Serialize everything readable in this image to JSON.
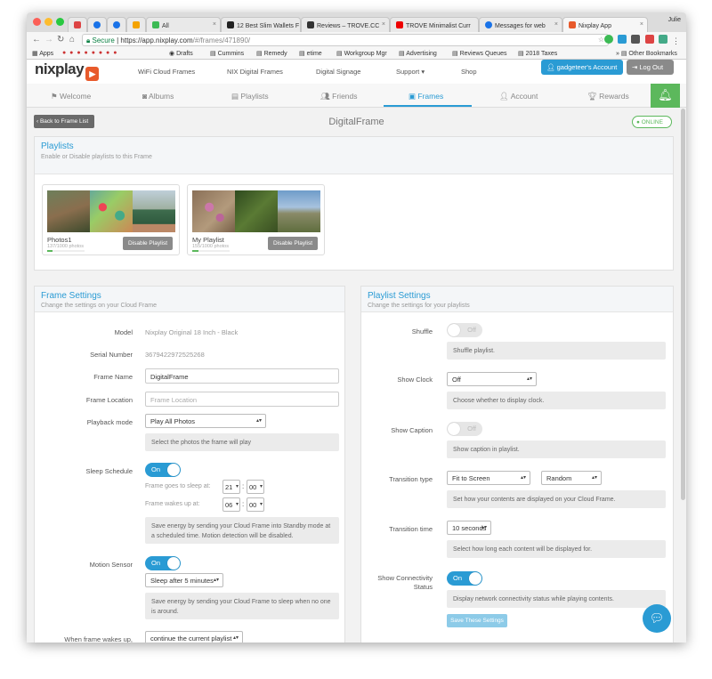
{
  "browser": {
    "tabs": [
      {
        "label": ""
      },
      {
        "label": ""
      },
      {
        "label": ""
      },
      {
        "label": ""
      },
      {
        "label": "All"
      },
      {
        "label": "12 Best Slim Wallets F"
      },
      {
        "label": "Reviews – TROVE.CC"
      },
      {
        "label": "TROVE Minimalist Curr"
      },
      {
        "label": "Messages for web"
      },
      {
        "label": "Nixplay App"
      }
    ],
    "user": "Julie",
    "secure_label": "Secure",
    "url_host": "https://app.nixplay.com",
    "url_path": "/#/frames/471890/",
    "bookmarks": [
      "Apps",
      "Drafts",
      "Cummins",
      "Remedy",
      "etime",
      "Workgroup Mgr",
      "Advertising",
      "Reviews Queues",
      "2018 Taxes",
      "Other Bookmarks"
    ]
  },
  "app": {
    "logo": "nixplay",
    "top_nav": [
      "WiFi Cloud Frames",
      "NIX Digital Frames",
      "Digital Signage",
      "Support ▾",
      "Shop"
    ],
    "account_button": "gadgeteer's Account",
    "logout_button": "Log Out",
    "sub_nav": [
      "Welcome",
      "Albums",
      "Playlists",
      "Friends",
      "Frames",
      "Account",
      "Rewards"
    ],
    "back_button": "‹ Back to Frame List",
    "frame_title": "DigitalFrame",
    "status": "ONLINE"
  },
  "playlists": {
    "title": "Playlists",
    "subtitle": "Enable or Disable playlists to this Frame",
    "items": [
      {
        "name": "Photos1",
        "count": "137/1000 photos",
        "progress": 0.137,
        "action": "Disable Playlist"
      },
      {
        "name": "My Playlist",
        "count": "155/1000 photos",
        "progress": 0.155,
        "action": "Disable Playlist"
      }
    ]
  },
  "frame_settings": {
    "title": "Frame Settings",
    "subtitle": "Change the settings on your Cloud Frame",
    "model_label": "Model",
    "model_value": "Nixplay Original 18 Inch - Black",
    "serial_label": "Serial Number",
    "serial_value": "3679422972525268",
    "name_label": "Frame Name",
    "name_value": "DigitalFrame",
    "location_label": "Frame Location",
    "location_placeholder": "Frame Location",
    "playback_label": "Playback mode",
    "playback_value": "Play All Photos",
    "playback_help": "Select the photos the frame will play",
    "sleep_label": "Sleep Schedule",
    "sleep_toggle": "On",
    "sleep_at_label": "Frame goes to sleep at:",
    "sleep_hour": "21",
    "sleep_min": "00",
    "wake_at_label": "Frame wakes up at:",
    "wake_hour": "06",
    "wake_min": "00",
    "sleep_help": "Save energy by sending your Cloud Frame into Standby mode at a scheduled time. Motion detection will be disabled.",
    "motion_label": "Motion Sensor",
    "motion_toggle": "On",
    "motion_value": "Sleep after 5 minutes",
    "motion_help": "Save energy by sending your Cloud Frame to sleep when no one is around.",
    "wake_label": "When frame wakes up,",
    "wake_value": "continue the current playlist"
  },
  "playlist_settings": {
    "title": "Playlist Settings",
    "subtitle": "Change the settings for your playlists",
    "shuffle_label": "Shuffle",
    "shuffle_toggle": "Off",
    "shuffle_help": "Shuffle playlist.",
    "clock_label": "Show Clock",
    "clock_value": "Off",
    "clock_help": "Choose whether to display clock.",
    "caption_label": "Show Caption",
    "caption_toggle": "Off",
    "caption_help": "Show caption in playlist.",
    "transition_type_label": "Transition type",
    "transition_type_value": "Fit to Screen",
    "transition_effect_value": "Random",
    "transition_type_help": "Set how your contents are displayed on your Cloud Frame.",
    "transition_time_label": "Transition time",
    "transition_time_value": "10 seconds",
    "transition_time_help": "Select how long each content will be displayed for.",
    "connectivity_label": "Show Connectivity Status",
    "connectivity_toggle": "On",
    "connectivity_help": "Display network connectivity status while playing contents.",
    "save_button": "Save These Settings"
  },
  "colors": {
    "accent": "#2a9bd4",
    "online": "#5cb85c",
    "brand": "#e85a2b"
  }
}
